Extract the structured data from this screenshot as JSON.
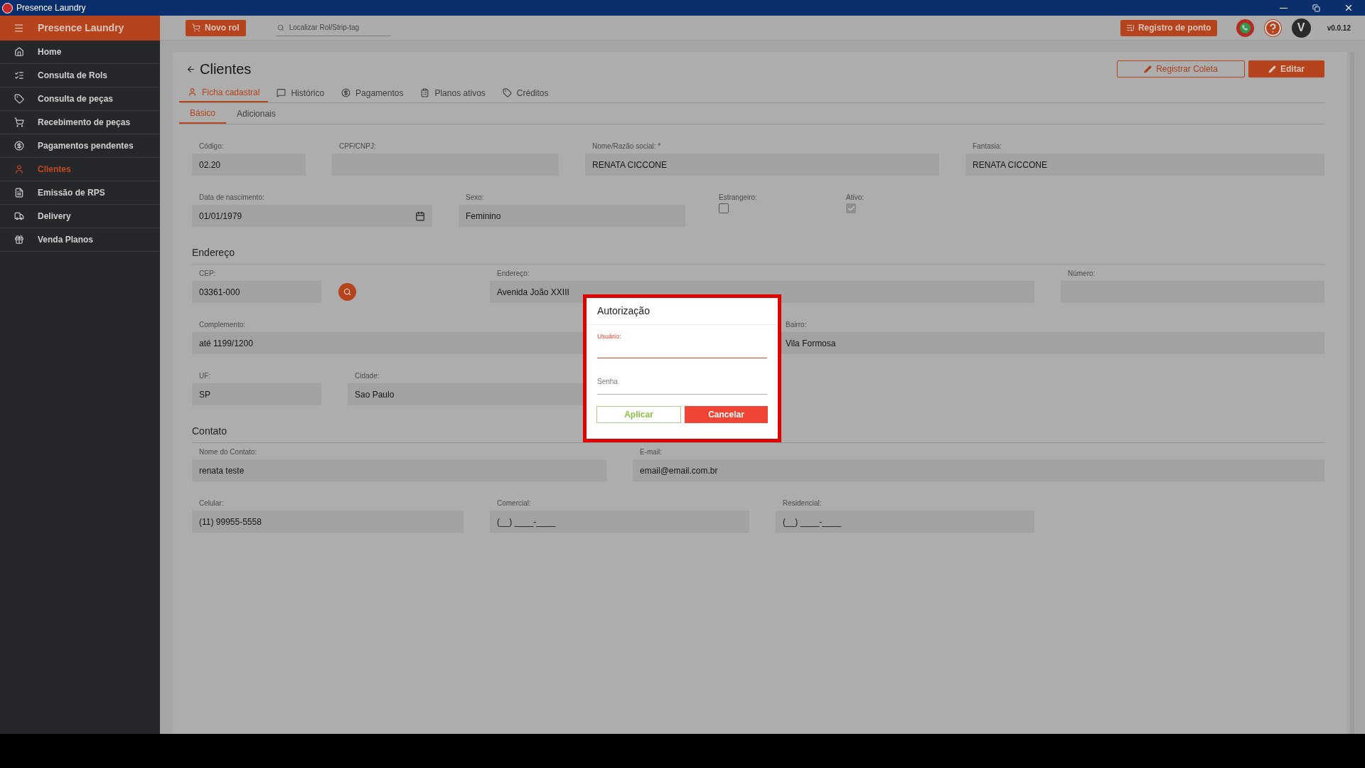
{
  "window": {
    "title": "Presence Laundry"
  },
  "sidebar": {
    "brand": "Presence Laundry",
    "items": [
      {
        "label": "Home",
        "selected": false
      },
      {
        "label": "Consulta de Rols",
        "selected": false
      },
      {
        "label": "Consulta de peças",
        "selected": false
      },
      {
        "label": "Recebimento de peças",
        "selected": false
      },
      {
        "label": "Pagamentos pendentes",
        "selected": false
      },
      {
        "label": "Clientes",
        "selected": true
      },
      {
        "label": "Emissão de RPS",
        "selected": false
      },
      {
        "label": "Delivery",
        "selected": false
      },
      {
        "label": "Venda Planos",
        "selected": false
      }
    ]
  },
  "topbar": {
    "new_button": "Novo rol",
    "search": {
      "placeholder": "Localizar Rol/Strip-tag"
    },
    "clock_button": "Registro de ponto",
    "avatar": "V",
    "version": "v0.0.12"
  },
  "page": {
    "title": "Clientes",
    "actions": [
      {
        "label": "Registrar Coleta",
        "kind": "outline"
      },
      {
        "label": "Editar",
        "kind": "filled"
      }
    ],
    "tabs": [
      {
        "label": "Ficha cadastral",
        "selected": true
      },
      {
        "label": "Histórico",
        "selected": false
      },
      {
        "label": "Pagamentos",
        "selected": false
      },
      {
        "label": "Planos ativos",
        "selected": false
      },
      {
        "label": "Créditos",
        "selected": false
      }
    ],
    "subtabs": [
      {
        "label": "Básico",
        "selected": true
      },
      {
        "label": "Adicionais",
        "selected": false
      }
    ],
    "sections": [
      {
        "rows": [
          [
            {
              "kind": "text",
              "label": "Código:",
              "value": "02.20"
            },
            {
              "kind": "blurred",
              "label": "CPF/CNPJ:"
            },
            {
              "kind": "text",
              "label": "Nome/Razão social: *",
              "value": "RENATA CICCONE"
            },
            {
              "kind": "text",
              "label": "Fantasia:",
              "value": "RENATA CICCONE"
            }
          ],
          [
            {
              "kind": "date",
              "label": "Data de nascimento:",
              "value": "01/01/1979"
            },
            {
              "kind": "text",
              "label": "Sexo:",
              "value": "Feminino"
            },
            {
              "kind": "checkbox",
              "label": "Estrangeiro:",
              "checked": false,
              "disabled": false
            },
            {
              "kind": "checkbox",
              "label": "Ativo:",
              "checked": true,
              "disabled": true
            }
          ]
        ]
      },
      {
        "title": "Endereço",
        "rows": [
          [
            {
              "kind": "text",
              "label": "CEP:",
              "value": "03361-000"
            },
            {
              "kind": "search"
            },
            {
              "kind": "text",
              "label": "Endereço:",
              "value": "Avenida João XXIII"
            },
            {
              "kind": "text",
              "label": "Número:"
            }
          ],
          [
            {
              "kind": "text",
              "label": "Complemento:",
              "value": "até 1199/1200"
            },
            {
              "kind": "text",
              "label": "Bairro:",
              "value": "Vila Formosa"
            }
          ],
          [
            {
              "kind": "text",
              "label": "UF:",
              "value": "SP"
            },
            {
              "kind": "text",
              "label": "Cidade:",
              "value": "Sao Paulo"
            }
          ]
        ]
      },
      {
        "title": "Contato",
        "rows": [
          [
            {
              "kind": "text",
              "label": "Nome do Contato:",
              "value": "renata teste"
            },
            {
              "kind": "text",
              "label": "E-mail:",
              "value": "email@email.com.br"
            }
          ],
          [
            {
              "kind": "text",
              "label": "Celular:",
              "value": "(11) 99955-5558"
            },
            {
              "kind": "text",
              "label": "Comercial:",
              "value": "(__) ____-____"
            },
            {
              "kind": "text",
              "label": "Residencial:",
              "value": "(__) ____-____"
            }
          ]
        ]
      }
    ]
  },
  "dialog": {
    "title": "Autorização",
    "fields": [
      {
        "label": "Usuário:",
        "focused": true
      },
      {
        "label": "Senha",
        "focused": false
      }
    ],
    "buttons": [
      {
        "label": "Aplicar",
        "kind": "outline"
      },
      {
        "label": "Cancelar",
        "kind": "filled"
      }
    ]
  }
}
